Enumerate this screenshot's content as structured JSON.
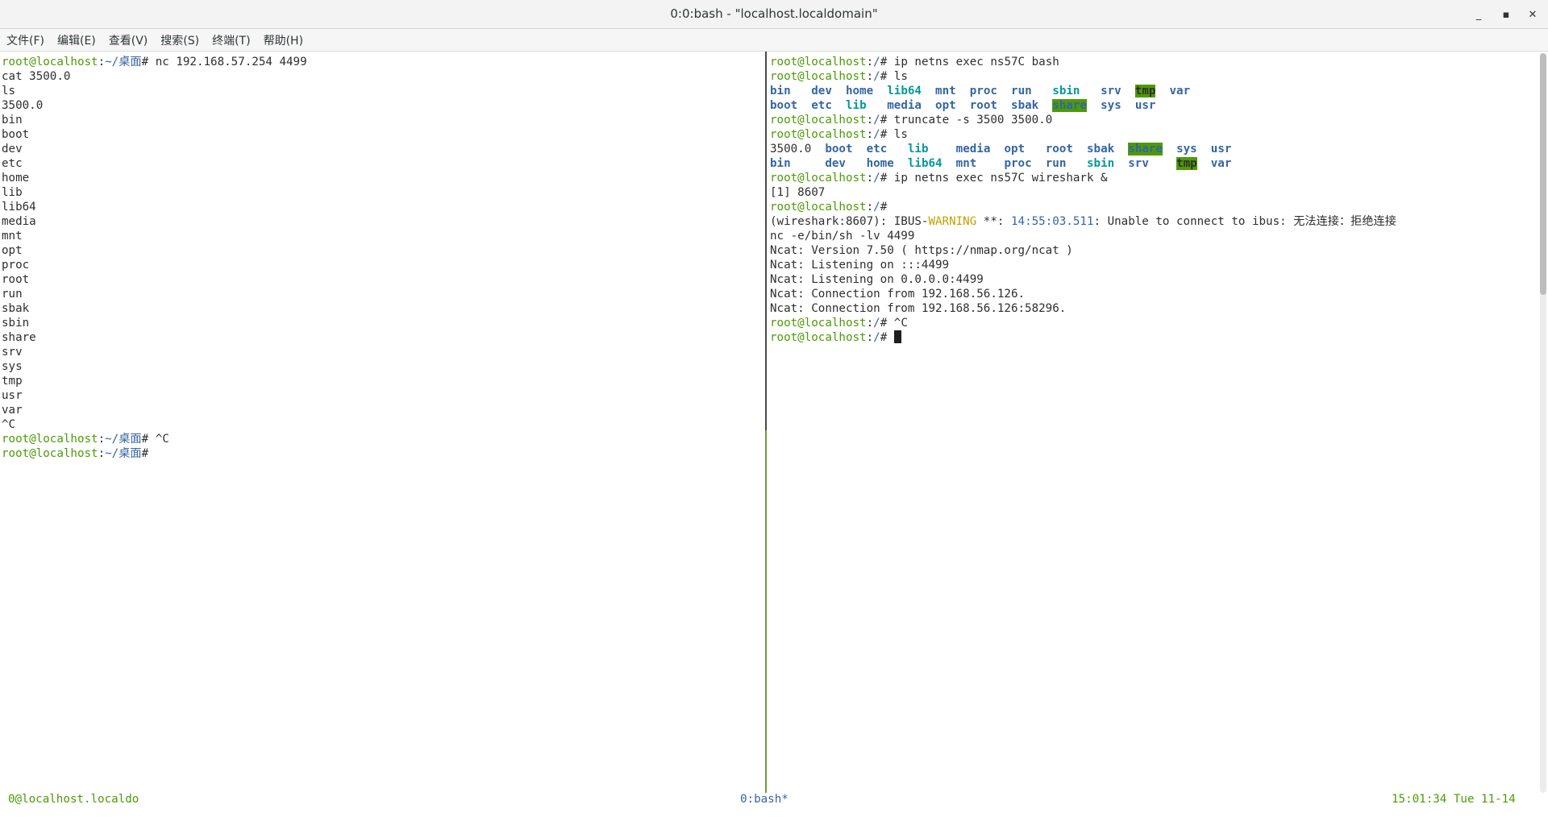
{
  "window": {
    "title": "0:0:bash - \"localhost.localdomain\"",
    "minimize_glyph": "_",
    "maximize_glyph": "▪",
    "close_glyph": "✕"
  },
  "menu": [
    "文件(F)",
    "编辑(E)",
    "查看(V)",
    "搜索(S)",
    "终端(T)",
    "帮助(H)"
  ],
  "left_pane": {
    "user": "root@localhost",
    "path": "~/桌面",
    "cmd_nc": " nc 192.168.57.254 4499",
    "out1": "cat 3500.0\nls\n3500.0\nbin\nboot\ndev\netc\nhome\nlib\nlib64\nmedia\nmnt\nopt\nproc\nroot\nrun\nsbak\nsbin\nshare\nsrv\nsys\ntmp\nusr\nvar\n^C",
    "cmd_ctrlc": " ^C"
  },
  "right_pane": {
    "user": "root@localhost",
    "path": "/",
    "cmd_netns": " ip netns exec ns57C bash",
    "cmd_ls": " ls",
    "cmd_truncate": " truncate -s 3500 3500.0",
    "file_3500": "3500.0",
    "dirs": {
      "bin": "bin",
      "boot": "boot",
      "dev": "dev",
      "etc": "etc",
      "home": "home",
      "lib": "lib",
      "lib64": "lib64",
      "media": "media",
      "mnt": "mnt",
      "opt": "opt",
      "proc": "proc",
      "root": "root",
      "run": "run",
      "sbak": "sbak",
      "sbin": "sbin",
      "share": "share",
      "srv": "srv",
      "sys": "sys",
      "tmp": "tmp",
      "usr": "usr",
      "var": "var"
    },
    "cmd_wireshark": " ip netns exec ns57C wireshark &",
    "job": "[1] 8607",
    "ws_prefix": "(wireshark:8607): IBUS-",
    "ws_warning": "WARNING",
    "ws_stars": " **: ",
    "ws_time": "14:55:03.511",
    "ws_msg": ": Unable to connect to ibus: 无法连接：拒绝连接",
    "ncat_lines": "nc -e/bin/sh -lv 4499\nNcat: Version 7.50 ( https://nmap.org/ncat )\nNcat: Listening on :::4499\nNcat: Listening on 0.0.0.0:4499\nNcat: Connection from 192.168.56.126.\nNcat: Connection from 192.168.56.126:58296.",
    "cmd_ctrlc": " ^C"
  },
  "status": {
    "left": "0@localhost.localdo",
    "middle": "0:bash*",
    "right": "15:01:34 Tue 11-14"
  }
}
